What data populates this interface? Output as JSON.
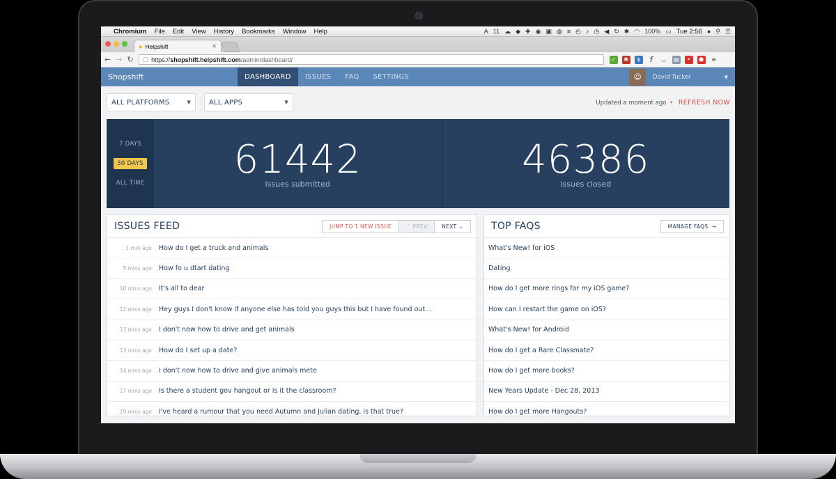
{
  "menubar": {
    "app": "Chromium",
    "items": [
      "File",
      "Edit",
      "View",
      "History",
      "Bookmarks",
      "Window",
      "Help"
    ],
    "status_num": "11",
    "battery": "100%",
    "clock": "Tue 2:56"
  },
  "browser": {
    "tab_title": "Helpshift",
    "url_prefix": "https://",
    "url_host": "shopshift.helpshift.com",
    "url_path": "/admin/dashboard/"
  },
  "header": {
    "brand": "Shopshift",
    "nav": [
      "DASHBOARD",
      "ISSUES",
      "FAQ",
      "SETTINGS"
    ],
    "user": "David Tucker"
  },
  "filters": {
    "platform": "ALL PLATFORMS",
    "apps": "ALL APPS",
    "updated": "Updated a moment ago",
    "refresh": "REFRESH NOW"
  },
  "stats": {
    "ranges": [
      "7 DAYS",
      "30 DAYS",
      "ALL TIME"
    ],
    "active_range": "30 DAYS",
    "submitted_value": "61442",
    "submitted_label": "issues submitted",
    "closed_value": "46386",
    "closed_label": "issues closed"
  },
  "issues_feed": {
    "title": "ISSUES FEED",
    "jump": "JUMP TO 1 NEW ISSUE",
    "prev": "PREV",
    "next": "NEXT",
    "rows": [
      {
        "time": "1 min ago",
        "text": "How do I get a truck and animals"
      },
      {
        "time": "5 mins ago",
        "text": "How fo u dtart dating"
      },
      {
        "time": "10 mins ago",
        "text": "It's all to dear"
      },
      {
        "time": "12 mins ago",
        "text": "Hey guys I don't know if anyone else has told you guys this but I have found out..."
      },
      {
        "time": "13 mins ago",
        "text": "I don't now how to drive and get animals"
      },
      {
        "time": "13 mins ago",
        "text": "How do I set up a date?"
      },
      {
        "time": "14 mins ago",
        "text": "I don't now how to drive and give animals mete"
      },
      {
        "time": "17 mins ago",
        "text": "Is there a student gov hangout or is it the classroom?"
      },
      {
        "time": "19 mins ago",
        "text": "I've heard a rumour that you need Autumn and Julian dating, is that true?"
      }
    ]
  },
  "top_faqs": {
    "title": "TOP FAQS",
    "manage": "MANAGE FAQS",
    "rows": [
      "What's New! for iOS",
      "Dating",
      "How do I get more rings for my iOS game?",
      "How can I restart the game on iOS?",
      "What's New! for Android",
      "How do I get a Rare Classmate?",
      "How do I get more books?",
      "New Years Update - Dec 28, 2013",
      "How do I get more Hangouts?"
    ]
  },
  "colors": {
    "navy": "#27405f",
    "header_blue": "#5b86b8",
    "accent_red": "#d9534f",
    "range_highlight": "#f1c84b"
  }
}
